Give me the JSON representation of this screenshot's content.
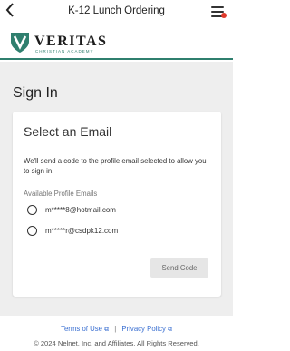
{
  "header": {
    "title": "K-12 Lunch Ordering",
    "back_icon": "chevron-left-icon",
    "menu_icon": "hamburger-menu-icon",
    "notification_color": "#e0392b"
  },
  "logo": {
    "name": "VERITAS",
    "subtitle": "CHRISTIAN ACADEMY",
    "brand_color": "#2f7f6e"
  },
  "page": {
    "heading": "Sign In"
  },
  "card": {
    "title": "Select an Email",
    "description": "We'll send a code to the profile email selected to allow you to sign in.",
    "emails_label": "Available Profile Emails",
    "emails": [
      {
        "label": "m*****8@hotmail.com",
        "selected": false
      },
      {
        "label": "m*****r@csdpk12.com",
        "selected": false
      }
    ],
    "send_button": "Send Code"
  },
  "footer": {
    "terms": "Terms of Use",
    "separator": "|",
    "privacy": "Privacy Policy",
    "external_icon": "external-link-icon",
    "copyright": "© 2024 Nelnet, Inc. and Affiliates. All Rights Reserved."
  }
}
